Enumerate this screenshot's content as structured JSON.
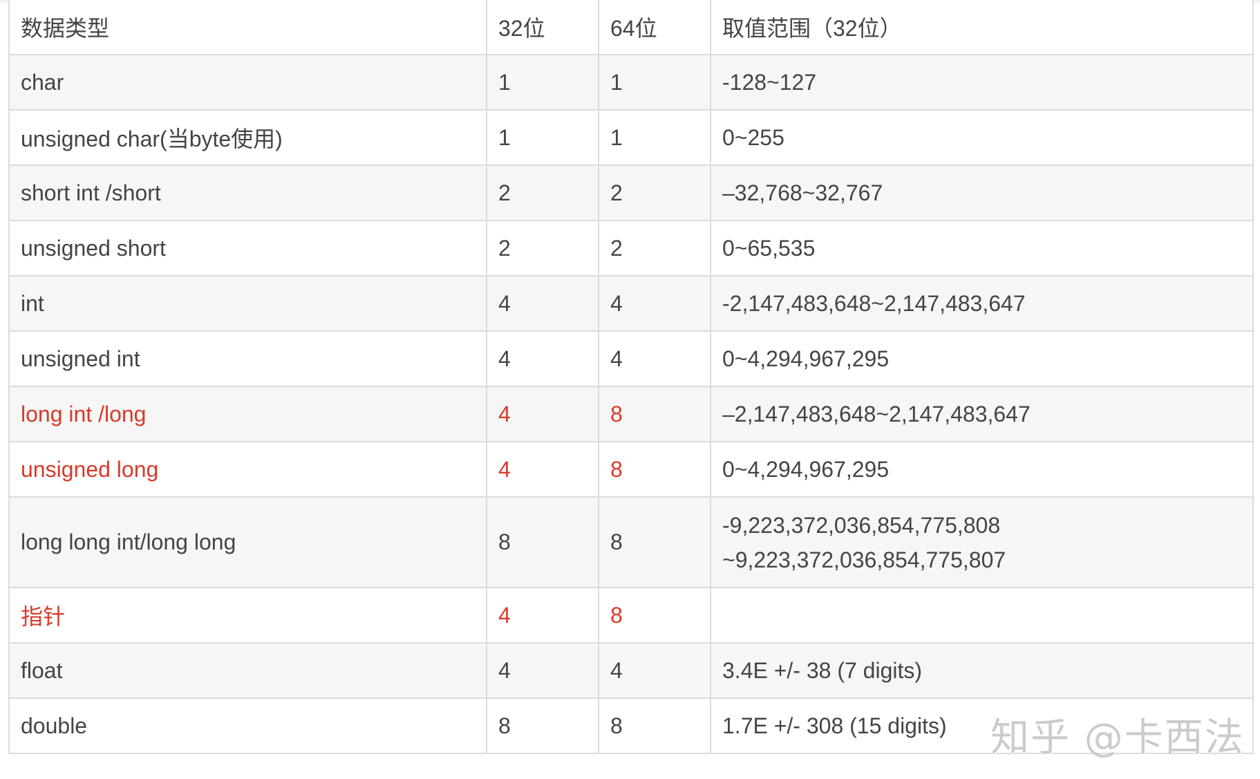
{
  "table": {
    "headers": [
      "数据类型",
      "32位",
      "64位",
      "取值范围（32位）"
    ],
    "rows": [
      {
        "type": "char",
        "bits32": "1",
        "bits64": "1",
        "range": [
          "-128~127"
        ],
        "highlight": false
      },
      {
        "type": "unsigned char(当byte使用)",
        "bits32": "1",
        "bits64": "1",
        "range": [
          "0~255"
        ],
        "highlight": false
      },
      {
        "type": "short int /short",
        "bits32": "2",
        "bits64": "2",
        "range": [
          "–32,768~32,767"
        ],
        "highlight": false
      },
      {
        "type": "unsigned  short",
        "bits32": "2",
        "bits64": "2",
        "range": [
          "0~65,535"
        ],
        "highlight": false
      },
      {
        "type": "int",
        "bits32": "4",
        "bits64": "4",
        "range": [
          "-2,147,483,648~2,147,483,647"
        ],
        "highlight": false
      },
      {
        "type": "unsigned int",
        "bits32": "4",
        "bits64": "4",
        "range": [
          "0~4,294,967,295"
        ],
        "highlight": false
      },
      {
        "type": "long int /long",
        "bits32": "4",
        "bits64": "8",
        "range": [
          "–2,147,483,648~2,147,483,647"
        ],
        "highlight": true
      },
      {
        "type": "unsigned long",
        "bits32": "4",
        "bits64": "8",
        "range": [
          "0~4,294,967,295"
        ],
        "highlight": true
      },
      {
        "type": "long long int/long long",
        "bits32": "8",
        "bits64": "8",
        "range": [
          "-9,223,372,036,854,775,808",
          "~9,223,372,036,854,775,807"
        ],
        "highlight": false
      },
      {
        "type": "指针",
        "bits32": "4",
        "bits64": "8",
        "range": [],
        "highlight": true
      },
      {
        "type": "float",
        "bits32": "4",
        "bits64": "4",
        "range": [
          "3.4E +/- 38 (7 digits)"
        ],
        "highlight": false
      },
      {
        "type": "double",
        "bits32": "8",
        "bits64": "8",
        "range": [
          "1.7E +/- 308 (15 digits)"
        ],
        "highlight": false
      }
    ]
  },
  "watermark": "知乎 @卡西法",
  "colors": {
    "text": "#444444",
    "highlight": "#d93a2b",
    "stripe": "#f6f6f6",
    "border": "#dcdcdc"
  }
}
